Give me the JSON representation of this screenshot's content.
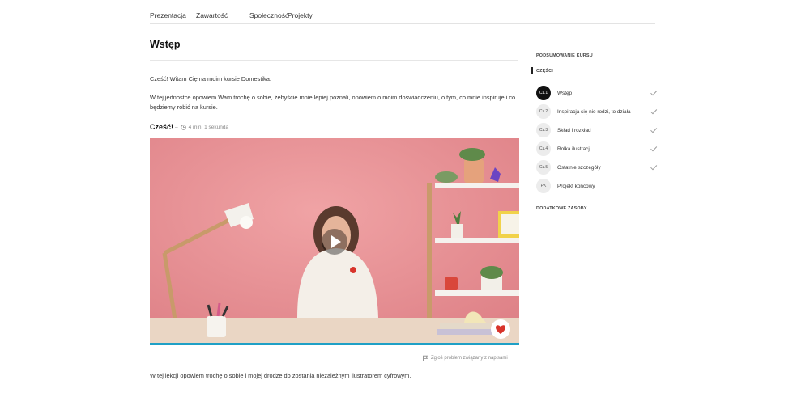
{
  "tabs": [
    {
      "label": "Prezentacja"
    },
    {
      "label": "Zawartość",
      "active": true
    },
    {
      "label": "Społeczność"
    },
    {
      "label": "Projekty"
    }
  ],
  "main": {
    "title": "Wstęp",
    "intro": "Cześć! Witam Cię na moim kursie Domestika.",
    "description": "W tej jednostce opowiem Wam trochę o sobie, żebyście mnie lepiej poznali, opowiem o moim doświadczeniu, o tym, co mnie inspiruje i co będziemy robić na kursie.",
    "lesson_title": "Cześć!",
    "lesson_sep": "–",
    "lesson_duration": "4 min, 1 sekunda",
    "report_link": "Zgłoś problem związany z napisami",
    "bottom_text": "W tej lekcji opowiem trochę o sobie i mojej drodze do zostania niezależnym ilustratorem cyfrowym."
  },
  "sidebar": {
    "summary_label": "PODSUMOWANIE KURSU",
    "parts_label": "CZĘŚCI",
    "items": [
      {
        "badge": "Cz.1",
        "label": "Wstęp",
        "active": true,
        "done": true
      },
      {
        "badge": "Cz.2",
        "label": "Inspiracja się nie rodzi, to działa",
        "done": true
      },
      {
        "badge": "Cz.3",
        "label": "Skład i rozkład",
        "done": true
      },
      {
        "badge": "Cz.4",
        "label": "Rolka ilustracji",
        "done": true
      },
      {
        "badge": "Cz.5",
        "label": "Ostatnie szczegóły",
        "done": true
      },
      {
        "badge": "PK",
        "label": "Projekt końcowy",
        "done": false
      }
    ],
    "extra_label": "DODATKOWE ZASOBY"
  },
  "colors": {
    "wall": "#e78e92",
    "desk": "#ead6c4",
    "progress": "#1fa0c6",
    "brand": "#d8342b"
  },
  "icons": [
    "clock-icon",
    "play-icon",
    "flag-icon",
    "check-icon",
    "domestika-logo-icon"
  ]
}
